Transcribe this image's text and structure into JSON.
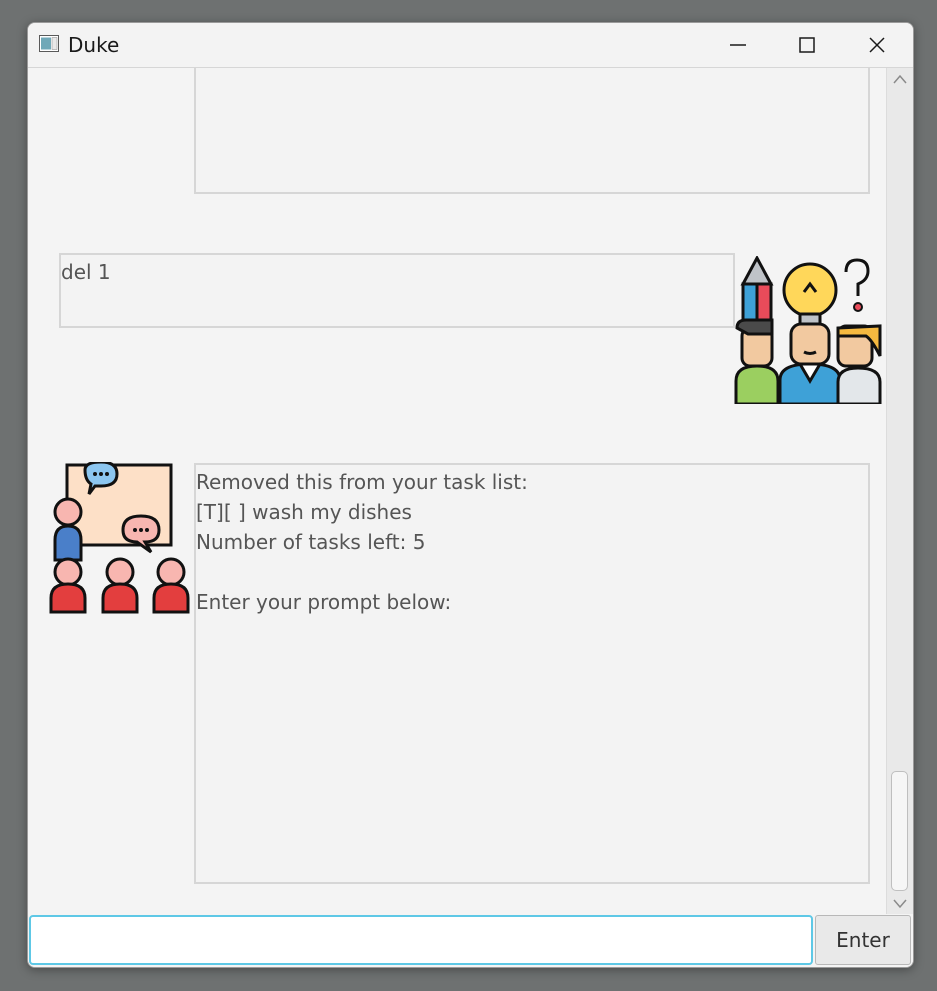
{
  "window": {
    "title": "Duke"
  },
  "chat": {
    "messages": [
      {
        "sender": "bot",
        "text": ""
      },
      {
        "sender": "user",
        "text": "del 1"
      },
      {
        "sender": "bot",
        "text": "Removed this from your task list:\n[T][ ] wash my dishes\nNumber of tasks left: 5\n\nEnter your prompt below:"
      }
    ]
  },
  "input": {
    "value": "",
    "placeholder": ""
  },
  "buttons": {
    "enter_label": "Enter"
  },
  "icons": {
    "app": "java-app-icon",
    "user_avatar": "team-ideas-icon",
    "bot_avatar": "teacher-class-icon"
  },
  "colors": {
    "input_focus_border": "#5ec8e6",
    "message_border": "#d6d6d6"
  }
}
